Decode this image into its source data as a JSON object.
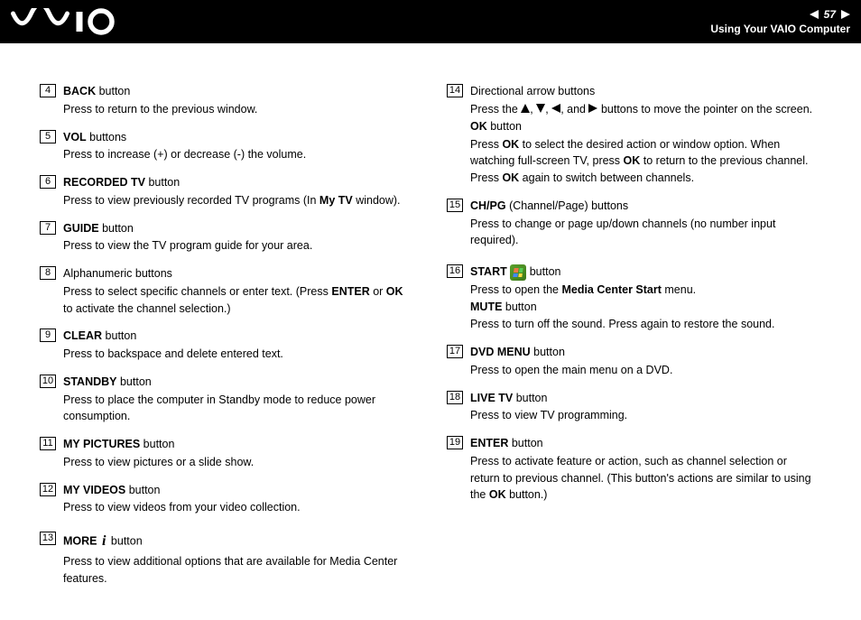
{
  "header": {
    "page_number": "57",
    "section_title": "Using Your VAIO Computer"
  },
  "items": {
    "4": {
      "title_bold": "BACK",
      "title_rest": " button",
      "desc": "Press to return to the previous window."
    },
    "5": {
      "title_bold": "VOL",
      "title_rest": " buttons",
      "desc": "Press to increase (+) or decrease (-) the volume."
    },
    "6": {
      "title_bold": "RECORDED TV",
      "title_rest": " button",
      "desc_pre": "Press to view previously recorded TV programs (In ",
      "desc_bold": "My TV",
      "desc_post": " window)."
    },
    "7": {
      "title_bold": "GUIDE",
      "title_rest": " button",
      "desc": "Press to view the TV program guide for your area."
    },
    "8": {
      "title_plain": "Alphanumeric buttons",
      "desc_pre": "Press to select specific channels or enter text. (Press ",
      "desc_bold": "ENTER",
      "desc_mid": " or ",
      "desc_bold2": "OK",
      "desc_post": " to activate the channel selection.)"
    },
    "9": {
      "title_bold": "CLEAR",
      "title_rest": " button",
      "desc": "Press to backspace and delete entered text."
    },
    "10": {
      "title_bold": "STANDBY",
      "title_rest": " button",
      "desc": "Press to place the computer in Standby mode to reduce power consumption."
    },
    "11": {
      "title_bold": "MY PICTURES",
      "title_rest": " button",
      "desc": "Press to view pictures or a slide show."
    },
    "12": {
      "title_bold": "MY VIDEOS",
      "title_rest": " button",
      "desc": "Press to view videos from your video collection."
    },
    "13": {
      "title_bold": "MORE",
      "title_rest": " button",
      "icon": "more",
      "desc": "Press to view additional options that are available for Media Center features."
    },
    "14": {
      "title_plain": "Directional arrow buttons",
      "arrow_pre": "Press the ",
      "arrow_mid": ", and ",
      "arrow_post": " buttons to move the pointer on the screen.",
      "sub_title_bold": "OK",
      "sub_title_rest": " button",
      "sub_desc_pre": "Press ",
      "sub_desc_b1": "OK",
      "sub_desc_mid1": " to select the desired action or window option. When watching full-screen TV, press ",
      "sub_desc_b2": "OK",
      "sub_desc_mid2": " to return to the previous channel. Press ",
      "sub_desc_b3": "OK",
      "sub_desc_post": " again to switch between channels."
    },
    "15": {
      "title_bold": "CH/PG",
      "title_rest": " (Channel/Page) buttons",
      "desc": "Press to change or page up/down channels (no number input required)."
    },
    "16": {
      "title_bold": "START",
      "title_rest": " button",
      "icon": "start",
      "desc_pre": "Press to open the ",
      "desc_bold": "Media Center Start",
      "desc_post": " menu.",
      "sub_title_bold": "MUTE",
      "sub_title_rest": " button",
      "sub_desc": "Press to turn off the sound. Press again to restore the sound."
    },
    "17": {
      "title_bold": "DVD MENU",
      "title_rest": " button",
      "desc": "Press to open the main menu on a DVD."
    },
    "18": {
      "title_bold": "LIVE TV",
      "title_rest": " button",
      "desc": "Press to view TV programming."
    },
    "19": {
      "title_bold": "ENTER",
      "title_rest": " button",
      "desc_pre": "Press to activate feature or action, such as channel selection or return to previous channel. (This button's actions are similar to using the ",
      "desc_bold": "OK",
      "desc_post": " button.)"
    }
  },
  "numbers": {
    "4": "4",
    "5": "5",
    "6": "6",
    "7": "7",
    "8": "8",
    "9": "9",
    "10": "10",
    "11": "11",
    "12": "12",
    "13": "13",
    "14": "14",
    "15": "15",
    "16": "16",
    "17": "17",
    "18": "18",
    "19": "19"
  }
}
